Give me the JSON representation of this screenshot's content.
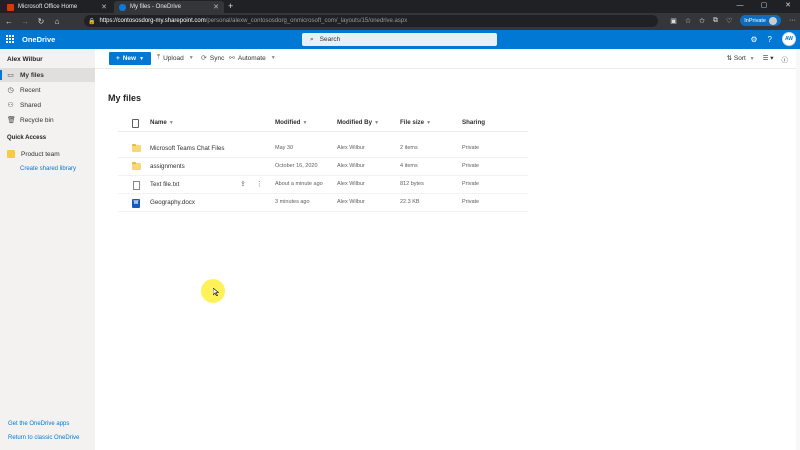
{
  "browser": {
    "tabs": [
      {
        "title": "Microsoft Office Home",
        "active": false
      },
      {
        "title": "My files - OneDrive",
        "active": true
      }
    ],
    "url_host": "https://contososdorg-my.sharepoint.com",
    "url_path": "/personal/alexw_contososdorg_onmicrosoft_com/_layouts/15/onedrive.aspx",
    "inprivate_label": "InPrivate"
  },
  "suite": {
    "app_name": "OneDrive",
    "search_placeholder": "Search",
    "avatar_initials": "AW"
  },
  "leftnav": {
    "user": "Alex Wilbur",
    "items": [
      {
        "label": "My files",
        "selected": true,
        "icon": "folder-icon"
      },
      {
        "label": "Recent",
        "selected": false,
        "icon": "clock-icon"
      },
      {
        "label": "Shared",
        "selected": false,
        "icon": "people-icon"
      },
      {
        "label": "Recycle bin",
        "selected": false,
        "icon": "trash-icon"
      }
    ],
    "quick_access_title": "Quick Access",
    "quick_access_items": [
      {
        "label": "Product team"
      }
    ],
    "create_link": "Create shared library",
    "get_apps": "Get the OneDrive apps",
    "return_classic": "Return to classic OneDrive"
  },
  "commandbar": {
    "new_label": "New",
    "upload_label": "Upload",
    "sync_label": "Sync",
    "automate_label": "Automate",
    "sort_label": "Sort"
  },
  "main": {
    "title": "My files",
    "columns": {
      "name": "Name",
      "modified": "Modified",
      "modified_by": "Modified By",
      "file_size": "File size",
      "sharing": "Sharing"
    },
    "rows": [
      {
        "name": "Microsoft Teams Chat Files",
        "type": "folder",
        "modified": "May 30",
        "modified_by": "Alex Wilbur",
        "size": "2 items",
        "sharing": "Private"
      },
      {
        "name": "assignments",
        "type": "folder",
        "modified": "October 16, 2020",
        "modified_by": "Alex Wilbur",
        "size": "4 items",
        "sharing": "Private"
      },
      {
        "name": "Text file.txt",
        "type": "txt",
        "modified": "About a minute ago",
        "modified_by": "Alex Wilbur",
        "size": "812 bytes",
        "sharing": "Private"
      },
      {
        "name": "Geography.docx",
        "type": "docx",
        "modified": "3 minutes ago",
        "modified_by": "Alex Wilbur",
        "size": "22.3 KB",
        "sharing": "Private"
      }
    ]
  },
  "colors": {
    "brand": "#0078d4",
    "nav_bg": "#f3f2f1",
    "folder": "#f8d775",
    "cursor_highlight": "#fff03c"
  }
}
